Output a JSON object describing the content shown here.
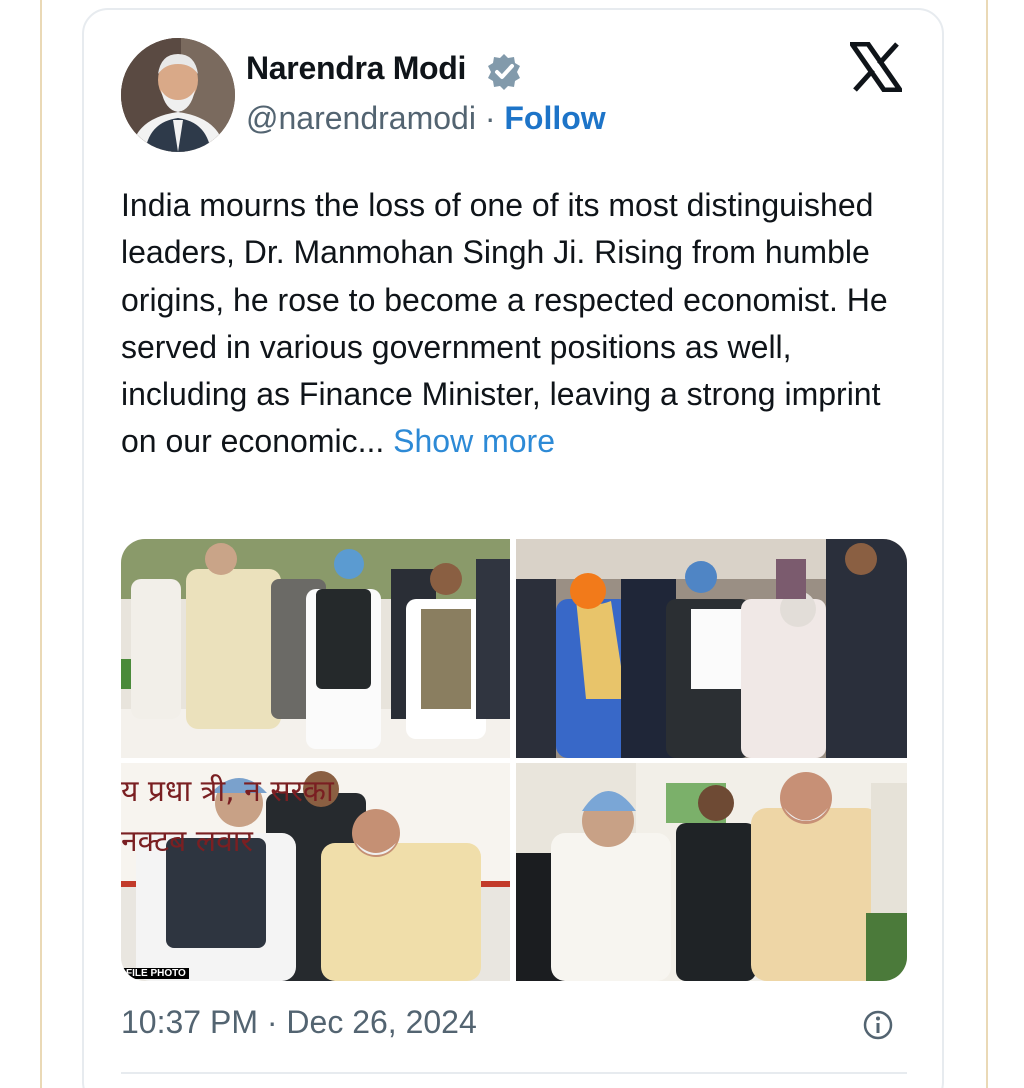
{
  "post": {
    "author_name": "Narendra Modi",
    "handle": "@narendramodi",
    "separator": "·",
    "follow_label": "Follow",
    "text": "India mourns the loss of one of its most distinguished leaders, Dr. Manmohan Singh Ji. Rising from humble origins, he rose to become a respected economist. He served in various government positions as well, including as Finance Minister, leaving a strong imprint on our economic...",
    "show_more_label": "Show more",
    "timestamp": "10:37 PM · Dec 26, 2024"
  },
  "media": {
    "photo3_banner_text_1": "य प्रधा  त्री,    न सरका",
    "photo3_banner_text_2": "नक्टब              लवार",
    "photo3_watermark": "FILE PHOTO"
  },
  "icons": {
    "verified": "verified-badge-icon",
    "brand": "x-logo-icon",
    "info": "info-icon"
  },
  "colors": {
    "text": "#0f1419",
    "secondary": "#536471",
    "follow": "#1d74c8",
    "show_more": "#2d8ad6",
    "border": "#e7ebef"
  }
}
